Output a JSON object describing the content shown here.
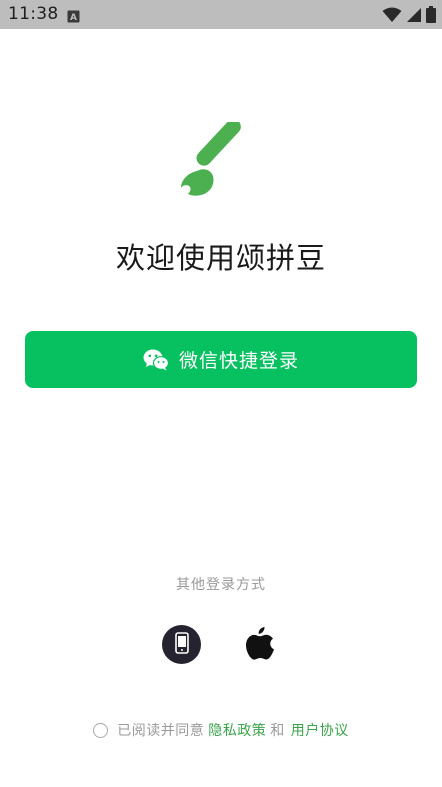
{
  "status_bar": {
    "time": "11:38",
    "icons": [
      "notification-a-icon",
      "wifi-icon",
      "signal-icon",
      "battery-icon"
    ]
  },
  "logo": {
    "icon": "paintbrush-icon",
    "color": "#4caf50"
  },
  "welcome": {
    "title": "欢迎使用颂拼豆"
  },
  "wechat_login": {
    "label": "微信快捷登录",
    "icon": "wechat-icon",
    "background": "#07c160"
  },
  "other_login": {
    "label": "其他登录方式",
    "options": [
      {
        "icon": "phone-icon"
      },
      {
        "icon": "apple-icon"
      }
    ]
  },
  "agreement": {
    "prefix": "已阅读并同意",
    "privacy_link": "隐私政策",
    "conjunction": "和",
    "terms_link": "用户协议",
    "link_color": "#3aa54a"
  }
}
